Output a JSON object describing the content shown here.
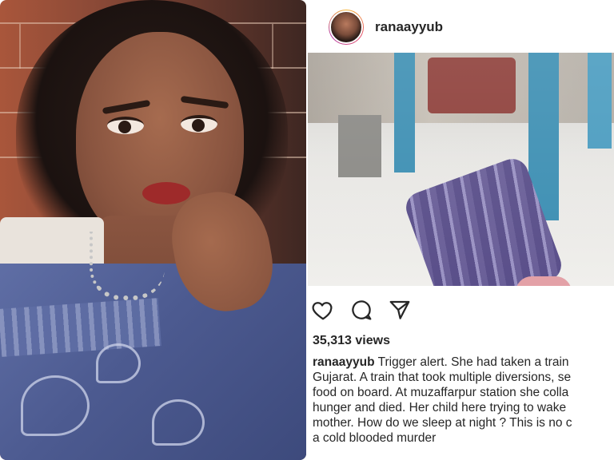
{
  "post": {
    "username": "ranaayyub",
    "views": "35,313 views",
    "caption_lines": [
      "Trigger alert. She had taken a train",
      "Gujarat. A train that took multiple diversions, se",
      "food on board. At muzaffarpur station she colla",
      "hunger and died. Her child here trying to wake",
      "mother. How do we sleep at night ? This is no c",
      "a cold blooded murder"
    ]
  },
  "icons": {
    "like": "heart-icon",
    "comment": "comment-icon",
    "share": "send-icon"
  },
  "colors": {
    "text": "#262626",
    "accent": "#3d8fb3"
  }
}
